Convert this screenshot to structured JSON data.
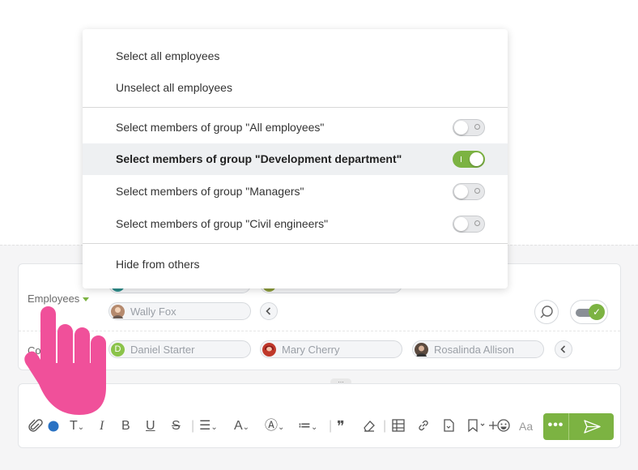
{
  "menu": {
    "items": [
      {
        "label": "Select all employees"
      },
      {
        "label": "Unselect all employees"
      },
      {
        "label": "Select members of group \"All employees\"",
        "toggle": false
      },
      {
        "label": "Select members of group \"Development department\"",
        "toggle": true
      },
      {
        "label": "Select members of group \"Managers\"",
        "toggle": false
      },
      {
        "label": "Select members of group \"Civil engineers\"",
        "toggle": false
      },
      {
        "label": "Hide from others"
      }
    ]
  },
  "recipients": {
    "employees_label": "Employees",
    "cc_label": "Copy",
    "employees_chips": [
      "Wally Fox"
    ],
    "cc_chips": [
      "Daniel Starter",
      "Mary Cherry",
      "Rosalinda Allison"
    ],
    "avatar_initial": "D"
  },
  "toolbar": {
    "icons": [
      "paperclip-icon",
      "color-dot-icon",
      "text-style-icon",
      "italic-icon",
      "bold-icon",
      "underline-icon",
      "strikethrough-icon",
      "align-icon",
      "font-size-icon",
      "font-color-icon",
      "list-icon",
      "quote-icon",
      "eraser-icon",
      "table-icon",
      "link-icon",
      "file-icon",
      "bookmark-icon",
      "plus-icon",
      "emoji-icon",
      "text-case-icon"
    ],
    "more_label": "•••",
    "colors": {
      "accent": "#7cb342",
      "dot": "#2a72c3",
      "hand": "#f0509a"
    }
  }
}
